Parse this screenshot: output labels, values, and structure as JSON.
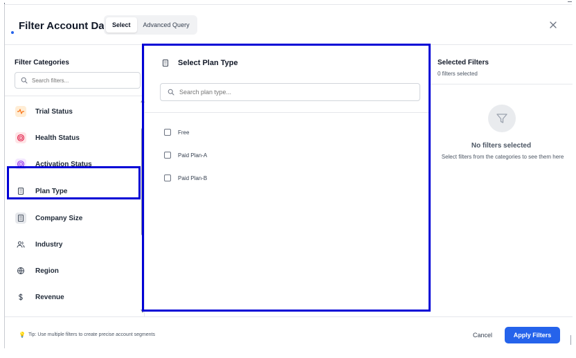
{
  "header": {
    "title": "Filter Account Data",
    "tabs": [
      {
        "label": "Select",
        "active": true
      },
      {
        "label": "Advanced Query",
        "active": false
      }
    ],
    "close_icon": "close-icon"
  },
  "left": {
    "title": "Filter Categories",
    "search_placeholder": "Search filters...",
    "categories": [
      {
        "label": "Trial Status",
        "icon": "activity-icon",
        "color": "#f97316",
        "bg": "#ffedd5"
      },
      {
        "label": "Health Status",
        "icon": "target-icon",
        "color": "#e11d48",
        "bg": "#ffe4e6"
      },
      {
        "label": "Activation Status",
        "icon": "target-icon",
        "color": "#9333ea",
        "bg": "#f3e8ff"
      },
      {
        "label": "Plan Type",
        "icon": "building-icon",
        "color": "#374151",
        "bg": "transparent",
        "selected": true
      },
      {
        "label": "Company Size",
        "icon": "building-icon",
        "color": "#4b5563",
        "bg": "#e5e7eb"
      },
      {
        "label": "Industry",
        "icon": "users-icon",
        "color": "#374151",
        "bg": "transparent"
      },
      {
        "label": "Region",
        "icon": "globe-icon",
        "color": "#374151",
        "bg": "transparent"
      },
      {
        "label": "Revenue",
        "icon": "dollar-icon",
        "color": "#374151",
        "bg": "transparent"
      }
    ]
  },
  "middle": {
    "title": "Select Plan Type",
    "search_placeholder": "Search plan type...",
    "options": [
      {
        "label": "Free",
        "checked": false
      },
      {
        "label": "Paid Plan-A",
        "checked": false
      },
      {
        "label": "Paid Plan-B",
        "checked": false
      }
    ]
  },
  "right": {
    "title": "Selected Filters",
    "count_text": "0 filters selected",
    "empty_title": "No filters selected",
    "empty_desc": "Select filters from the categories to see them here"
  },
  "footer": {
    "tip": "Tip: Use multiple filters to create precise account segments",
    "cancel": "Cancel",
    "apply": "Apply Filters"
  },
  "colors": {
    "accent": "#2563eb",
    "highlight": "#0000d6"
  }
}
